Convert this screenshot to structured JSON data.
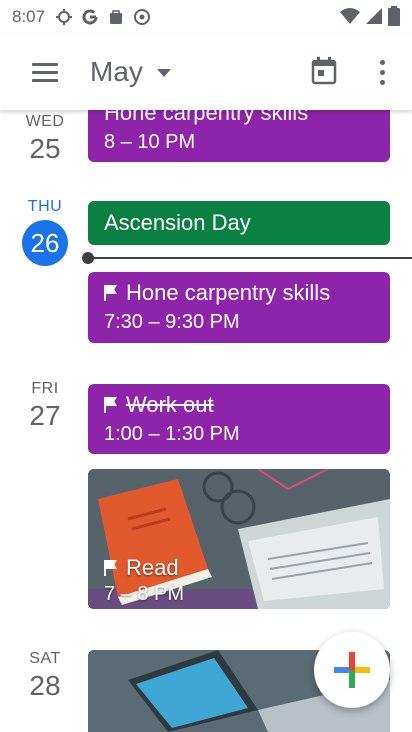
{
  "status_bar": {
    "time": "8:07"
  },
  "header": {
    "month": "May"
  },
  "days": [
    {
      "dow": "WED",
      "num": "25"
    },
    {
      "dow": "THU",
      "num": "26"
    },
    {
      "dow": "FRI",
      "num": "27"
    },
    {
      "dow": "SAT",
      "num": "28"
    }
  ],
  "events": {
    "wed_partial": {
      "title": "Hone carpentry skills",
      "time": "8 – 10 PM"
    },
    "ascension": {
      "title": "Ascension Day"
    },
    "hone": {
      "title": "Hone carpentry skills",
      "time": "7:30 – 9:30 PM"
    },
    "workout": {
      "title": "Work out",
      "time": "1:00 – 1:30 PM"
    },
    "read": {
      "title": "Read",
      "time": "7 – 8 PM"
    }
  },
  "colors": {
    "purple": "#8e24aa",
    "green": "#0b8043",
    "today_blue": "#1a73e8"
  }
}
